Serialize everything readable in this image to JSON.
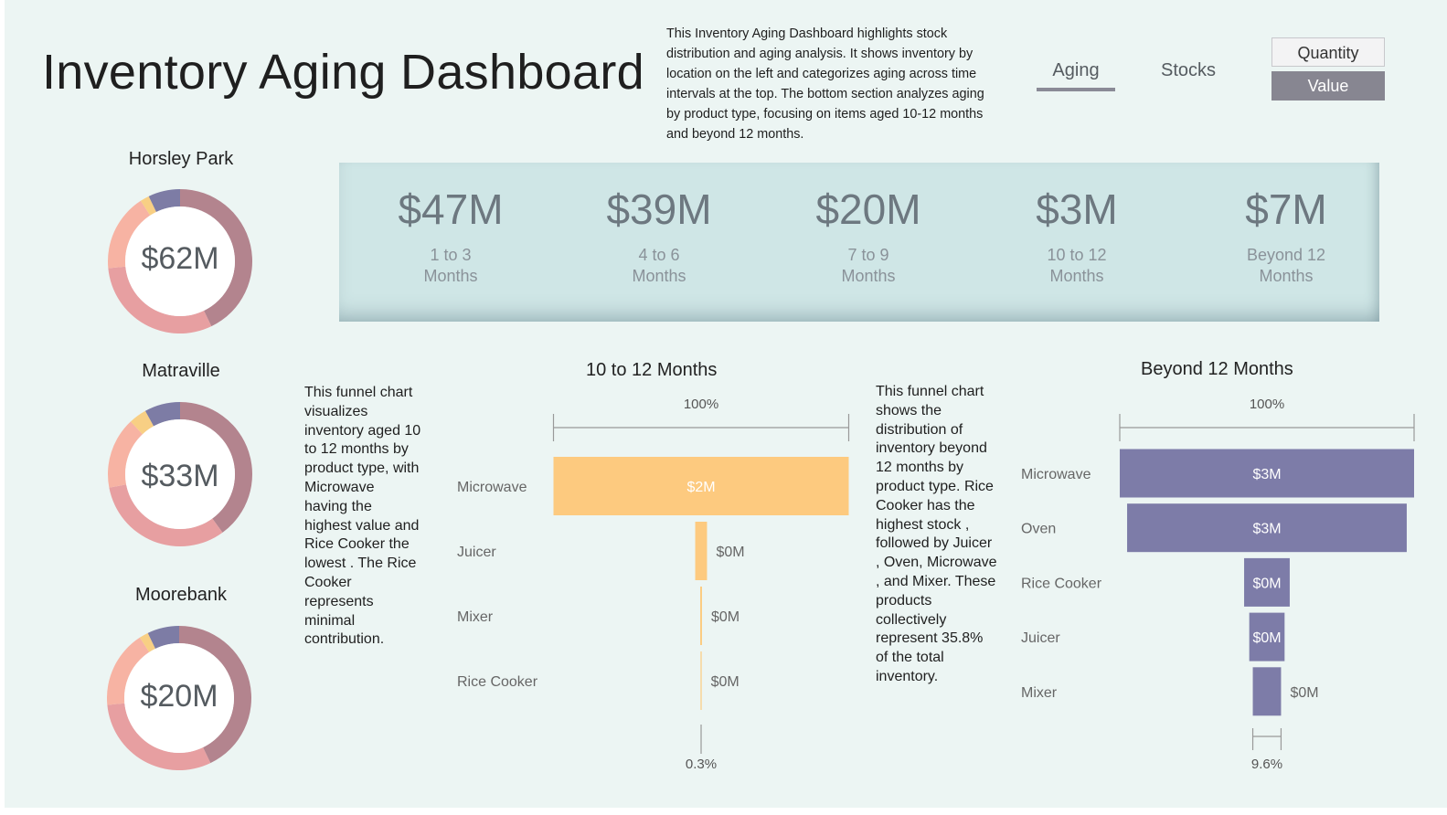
{
  "header": {
    "title": "Inventory Aging Dashboard",
    "description": "This Inventory Aging Dashboard highlights stock distribution and aging analysis. It shows inventory by location on the left and categorizes aging across time intervals at the top. The bottom section analyzes aging by product type, focusing on items aged 10-12 months and beyond 12 months."
  },
  "tabs": [
    {
      "label": "Aging",
      "active": true
    },
    {
      "label": "Stocks",
      "active": false
    }
  ],
  "toggle": [
    {
      "label": "Quantity",
      "selected": false
    },
    {
      "label": "Value",
      "selected": true
    }
  ],
  "colors": {
    "segment_main": "#b3848e",
    "segment_pink": "#e79fa1",
    "segment_peach": "#f7b3a3",
    "segment_yellow": "#f8cf84",
    "segment_purple": "#7d7ca5",
    "funnel_yellow": "#fdca7f",
    "funnel_purple": "#7d7ca8"
  },
  "locations": [
    {
      "name": "Horsley Park",
      "value": "$62M",
      "segments": [
        0.42,
        0.3,
        0.17,
        0.02,
        0.07
      ]
    },
    {
      "name": "Matraville",
      "value": "$33M",
      "segments": [
        0.4,
        0.32,
        0.16,
        0.04,
        0.08
      ]
    },
    {
      "name": "Moorebank",
      "value": "$20M",
      "segments": [
        0.42,
        0.3,
        0.17,
        0.02,
        0.07
      ]
    }
  ],
  "aging_buckets": [
    {
      "value": "$47M",
      "label_line1": "1 to 3",
      "label_line2": "Months"
    },
    {
      "value": "$39M",
      "label_line1": "4 to 6",
      "label_line2": "Months"
    },
    {
      "value": "$20M",
      "label_line1": "7 to 9",
      "label_line2": "Months"
    },
    {
      "value": "$3M",
      "label_line1": "10 to 12",
      "label_line2": "Months"
    },
    {
      "value": "$7M",
      "label_line1": "Beyond 12",
      "label_line2": "Months"
    }
  ],
  "descriptions": {
    "funnel_10_12": "This funnel chart visualizes inventory aged 10 to 12 months by product type, with Microwave having the highest value and Rice Cooker the lowest . The Rice Cooker represents minimal contribution.",
    "funnel_beyond_12": "This funnel chart shows the distribution of inventory beyond 12 months by product type. Rice Cooker has the highest stock , followed by Juicer , Oven, Microwave , and Mixer. These products collectively represent 35.8% of the total inventory."
  },
  "chart_data": [
    {
      "type": "bar",
      "title": "10 to 12 Months",
      "categories": [
        "Microwave",
        "Juicer",
        "Mixer",
        "Rice Cooker"
      ],
      "values": [
        100,
        4,
        0.6,
        0.3
      ],
      "data_labels": [
        "$2M",
        "$0M",
        "$0M",
        "$0M"
      ],
      "top_label": "100%",
      "bottom_label": "0.3%",
      "color": "#fdca7f"
    },
    {
      "type": "bar",
      "title": "Beyond 12 Months",
      "categories": [
        "Microwave",
        "Oven",
        "Rice Cooker",
        "Juicer",
        "Mixer"
      ],
      "values": [
        100,
        95,
        15.5,
        12,
        9.6
      ],
      "data_labels": [
        "$3M",
        "$3M",
        "$0M",
        "$0M",
        "$0M"
      ],
      "top_label": "100%",
      "bottom_label": "9.6%",
      "color": "#7d7ca8"
    }
  ]
}
